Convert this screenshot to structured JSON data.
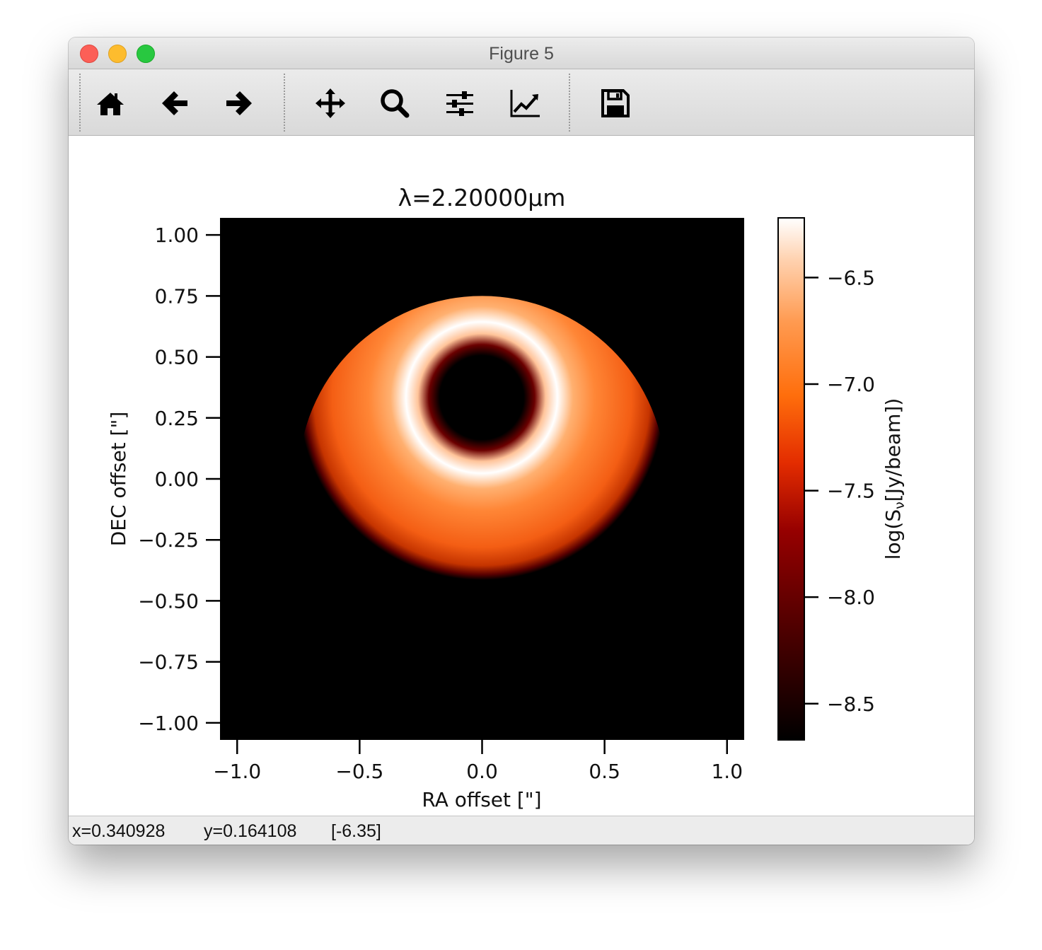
{
  "window": {
    "title": "Figure 5"
  },
  "toolbar": {
    "buttons": [
      {
        "name": "home",
        "icon": "home-icon"
      },
      {
        "name": "back",
        "icon": "arrow-left-icon"
      },
      {
        "name": "forward",
        "icon": "arrow-right-icon"
      },
      {
        "name": "pan",
        "icon": "move-icon"
      },
      {
        "name": "zoom",
        "icon": "magnifier-icon"
      },
      {
        "name": "subplots",
        "icon": "sliders-icon"
      },
      {
        "name": "customize",
        "icon": "line-chart-icon"
      },
      {
        "name": "save",
        "icon": "floppy-disk-icon"
      }
    ]
  },
  "status": {
    "x": "x=0.340928",
    "y": "y=0.164108",
    "value": "[-6.35]"
  },
  "chart_data": {
    "type": "heatmap",
    "title": "λ=2.20000μm",
    "xlabel": "RA offset [\"]",
    "ylabel": "DEC offset [\"]",
    "xlim": [
      -1.07,
      1.07
    ],
    "ylim": [
      -1.07,
      1.07
    ],
    "x_ticks": [
      "−1.0",
      "−0.5",
      "0.0",
      "0.5",
      "1.0"
    ],
    "x_tick_values": [
      -1.0,
      -0.5,
      0.0,
      0.5,
      1.0
    ],
    "y_ticks": [
      "1.00",
      "0.75",
      "0.50",
      "0.25",
      "0.00",
      "−0.25",
      "−0.50",
      "−0.75",
      "−1.00"
    ],
    "y_tick_values": [
      1.0,
      0.75,
      0.5,
      0.25,
      0.0,
      -0.25,
      -0.5,
      -0.75,
      -1.0
    ],
    "colormap": "gist_heat",
    "colorbar": {
      "label": "log(S",
      "label_sub": "ν",
      "label_tail": "[Jy/beam])",
      "range": [
        -8.67,
        -6.22
      ],
      "ticks": [
        "−6.5",
        "−7.0",
        "−7.5",
        "−8.0",
        "−8.5"
      ],
      "tick_values": [
        -6.5,
        -7.0,
        -7.5,
        -8.0,
        -8.5
      ]
    },
    "ring": {
      "inner_radius": 0.25,
      "peak_radius": 0.33,
      "outer_radius": 0.75,
      "peak_value": -6.22,
      "outer_value": -7.0
    }
  }
}
